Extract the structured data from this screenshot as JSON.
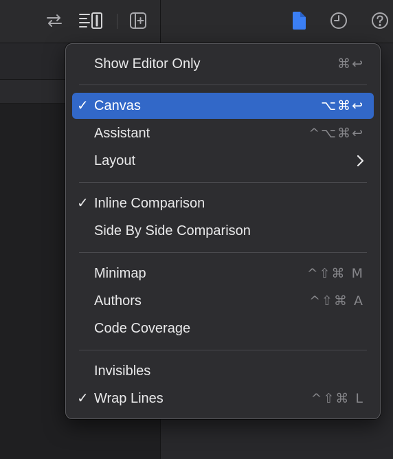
{
  "toolbar": {
    "icons": [
      "swap-arrows-icon",
      "editor-options-icon",
      "add-editor-icon",
      "file-inspector-icon",
      "history-inspector-icon",
      "help-inspector-icon"
    ]
  },
  "menu": {
    "items": [
      {
        "label": "Show Editor Only",
        "shortcut": "⌘↩",
        "checked": ""
      },
      {
        "label": "Canvas",
        "shortcut": "⌥⌘↩",
        "checked": "✓"
      },
      {
        "label": "Assistant",
        "shortcut": "^⌥⌘↩",
        "checked": ""
      },
      {
        "label": "Layout",
        "shortcut": "",
        "checked": ""
      },
      {
        "label": "Inline Comparison",
        "shortcut": "",
        "checked": "✓"
      },
      {
        "label": "Side By Side Comparison",
        "shortcut": "",
        "checked": ""
      },
      {
        "label": "Minimap",
        "shortcut": "^⇧⌘ M",
        "checked": ""
      },
      {
        "label": "Authors",
        "shortcut": "^⇧⌘ A",
        "checked": ""
      },
      {
        "label": "Code Coverage",
        "shortcut": "",
        "checked": ""
      },
      {
        "label": "Invisibles",
        "shortcut": "",
        "checked": ""
      },
      {
        "label": "Wrap Lines",
        "shortcut": "^⇧⌘ L",
        "checked": "✓"
      }
    ]
  },
  "colors": {
    "highlight": "#3268c8",
    "active_icon": "#3b7ff5",
    "menu_bg": "#2d2d30"
  }
}
